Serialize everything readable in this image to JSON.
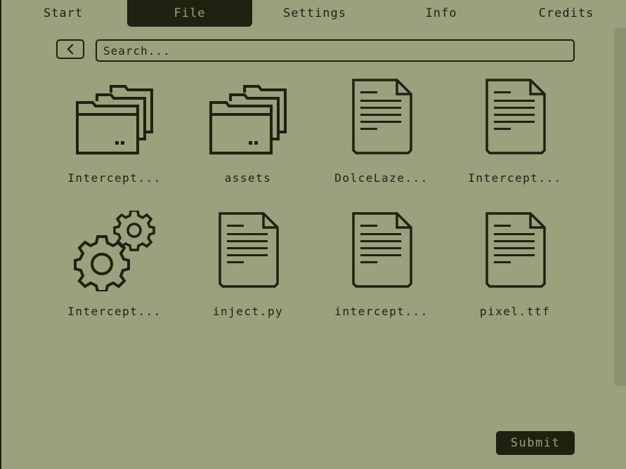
{
  "tabs": [
    {
      "label": "Start",
      "active": false
    },
    {
      "label": "File",
      "active": true
    },
    {
      "label": "Settings",
      "active": false
    },
    {
      "label": "Info",
      "active": false
    },
    {
      "label": "Credits",
      "active": false
    }
  ],
  "search": {
    "placeholder": "Search..."
  },
  "back_icon": "chevron-left-icon",
  "files": [
    {
      "name": "Intercept...",
      "icon": "folder-icon"
    },
    {
      "name": "assets",
      "icon": "folder-icon"
    },
    {
      "name": "DolceLaze...",
      "icon": "document-icon"
    },
    {
      "name": "Intercept...",
      "icon": "document-icon"
    },
    {
      "name": "Intercept...",
      "icon": "gears-icon"
    },
    {
      "name": "inject.py",
      "icon": "document-icon"
    },
    {
      "name": "intercept...",
      "icon": "document-icon"
    },
    {
      "name": "pixel.ttf",
      "icon": "document-icon"
    }
  ],
  "submit_label": "Submit",
  "colors": {
    "background": "#99a17d",
    "ink": "#1f2211",
    "scrollbar": "#8b9270"
  }
}
